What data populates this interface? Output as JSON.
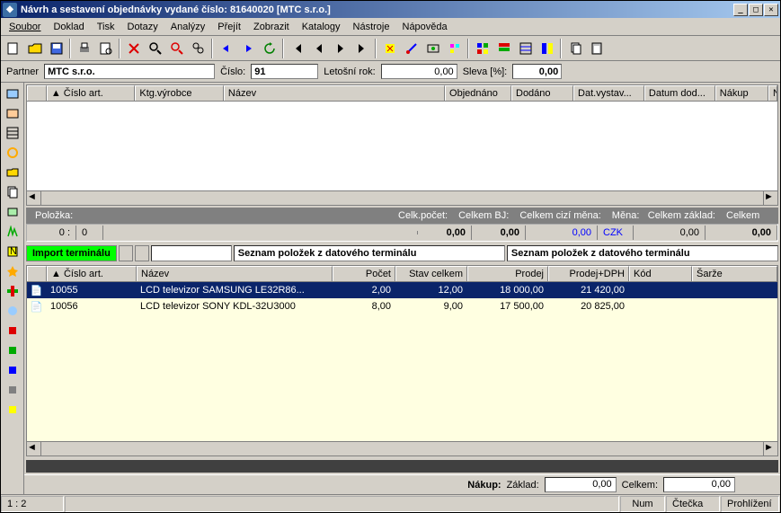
{
  "window": {
    "title": "Návrh a sestavení objednávky vydané číslo: 81640020 [MTC s.r.o.]"
  },
  "menu": [
    "Soubor",
    "Doklad",
    "Tisk",
    "Dotazy",
    "Analýzy",
    "Přejít",
    "Zobrazit",
    "Katalogy",
    "Nástroje",
    "Nápověda"
  ],
  "form": {
    "partner_label": "Partner",
    "partner_value": "MTC s.r.o.",
    "cislo_label": "Číslo:",
    "cislo_value": "91",
    "letosni_label": "Letošní rok:",
    "letosni_value": "0,00",
    "sleva_label": "Sleva [%]:",
    "sleva_value": "0,00"
  },
  "grid1": {
    "headers": [
      "▲  Číslo art.",
      "Ktg.výrobce",
      "Název",
      "Objednáno",
      "Dodáno",
      "Dat.vystav...",
      "Datum dod...",
      "Nákup",
      "Nákup v."
    ]
  },
  "status1": {
    "polozka": "Položka:",
    "celkpocet": "Celk.počet:",
    "celkembj": "Celkem BJ:",
    "celkemcizi": "Celkem cizí měna:",
    "mena": "Měna:",
    "celkemzaklad": "Celkem základ:",
    "celkem": "Celkem"
  },
  "sumrow": {
    "a": "0 :",
    "b": "0",
    "c": "0,00",
    "d": "0,00",
    "e": "0,00",
    "mena": "CZK",
    "f": "0,00",
    "g": "0,00"
  },
  "greenbar": {
    "import": "Import terminálu",
    "seznam1": "Seznam položek z datového terminálu",
    "seznam2": "Seznam položek z datového terminálu"
  },
  "grid2": {
    "headers": [
      "",
      "▲  Číslo art.",
      "Název",
      "Počet",
      "Stav celkem",
      "Prodej",
      "Prodej+DPH",
      "Kód",
      "Šarže"
    ],
    "rows": [
      {
        "ico": "📄",
        "cislo": "10055",
        "nazev": "LCD televizor SAMSUNG LE32R86...",
        "pocet": "2,00",
        "stav": "12,00",
        "prodej": "18 000,00",
        "proddph": "21 420,00",
        "kod": "",
        "sarze": "",
        "sel": true
      },
      {
        "ico": "📄",
        "cislo": "10056",
        "nazev": "LCD televizor SONY KDL-32U3000",
        "pocet": "8,00",
        "stav": "9,00",
        "prodej": "17 500,00",
        "proddph": "20 825,00",
        "kod": "",
        "sarze": "",
        "sel": false
      }
    ]
  },
  "bottom": {
    "nakup": "Nákup:",
    "zaklad": "Základ:",
    "zaklad_v": "0,00",
    "celkem": "Celkem:",
    "celkem_v": "0,00"
  },
  "status2": {
    "pos": "1 :   2",
    "num": "Num",
    "ctecka": "Čtečka",
    "prohlizeni": "Prohlížení"
  }
}
